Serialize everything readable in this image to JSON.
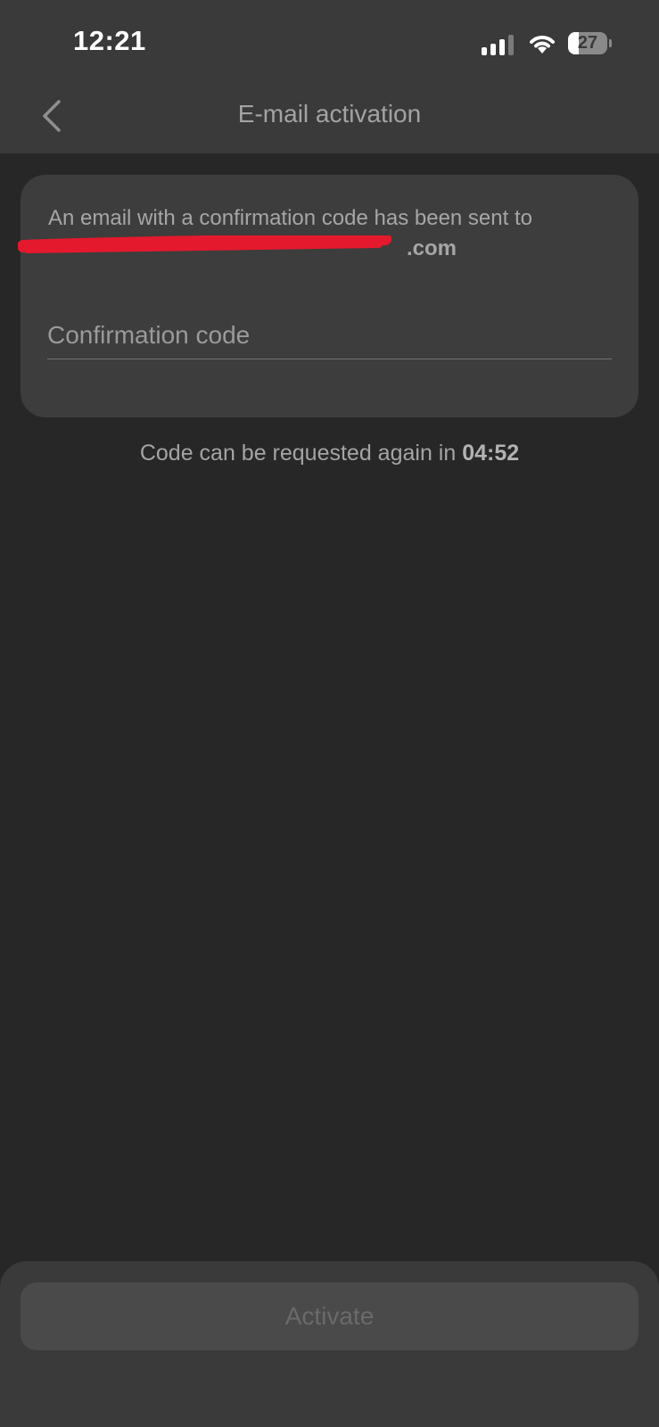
{
  "status_bar": {
    "time": "12:21",
    "battery_level": "27",
    "battery_fraction": 0.27,
    "signal_bars_active": 3,
    "signal_bars_total": 4
  },
  "header": {
    "title": "E-mail activation",
    "back_icon": "chevron-left-icon"
  },
  "card": {
    "message": "An email with a confirmation code has been sent to",
    "email_visible_part": ".com",
    "redaction_color": "#e4192d",
    "code_field": {
      "placeholder": "Confirmation code",
      "value": ""
    }
  },
  "resend": {
    "text": "Code can be requested again in",
    "countdown": "04:52"
  },
  "footer": {
    "activate_label": "Activate",
    "activate_enabled": false
  },
  "colors": {
    "background": "#272727",
    "surface": "#3d3d3d",
    "header": "#3a3a3a",
    "text_muted": "#a6a6a6",
    "button_disabled": "#4a4a4a"
  }
}
